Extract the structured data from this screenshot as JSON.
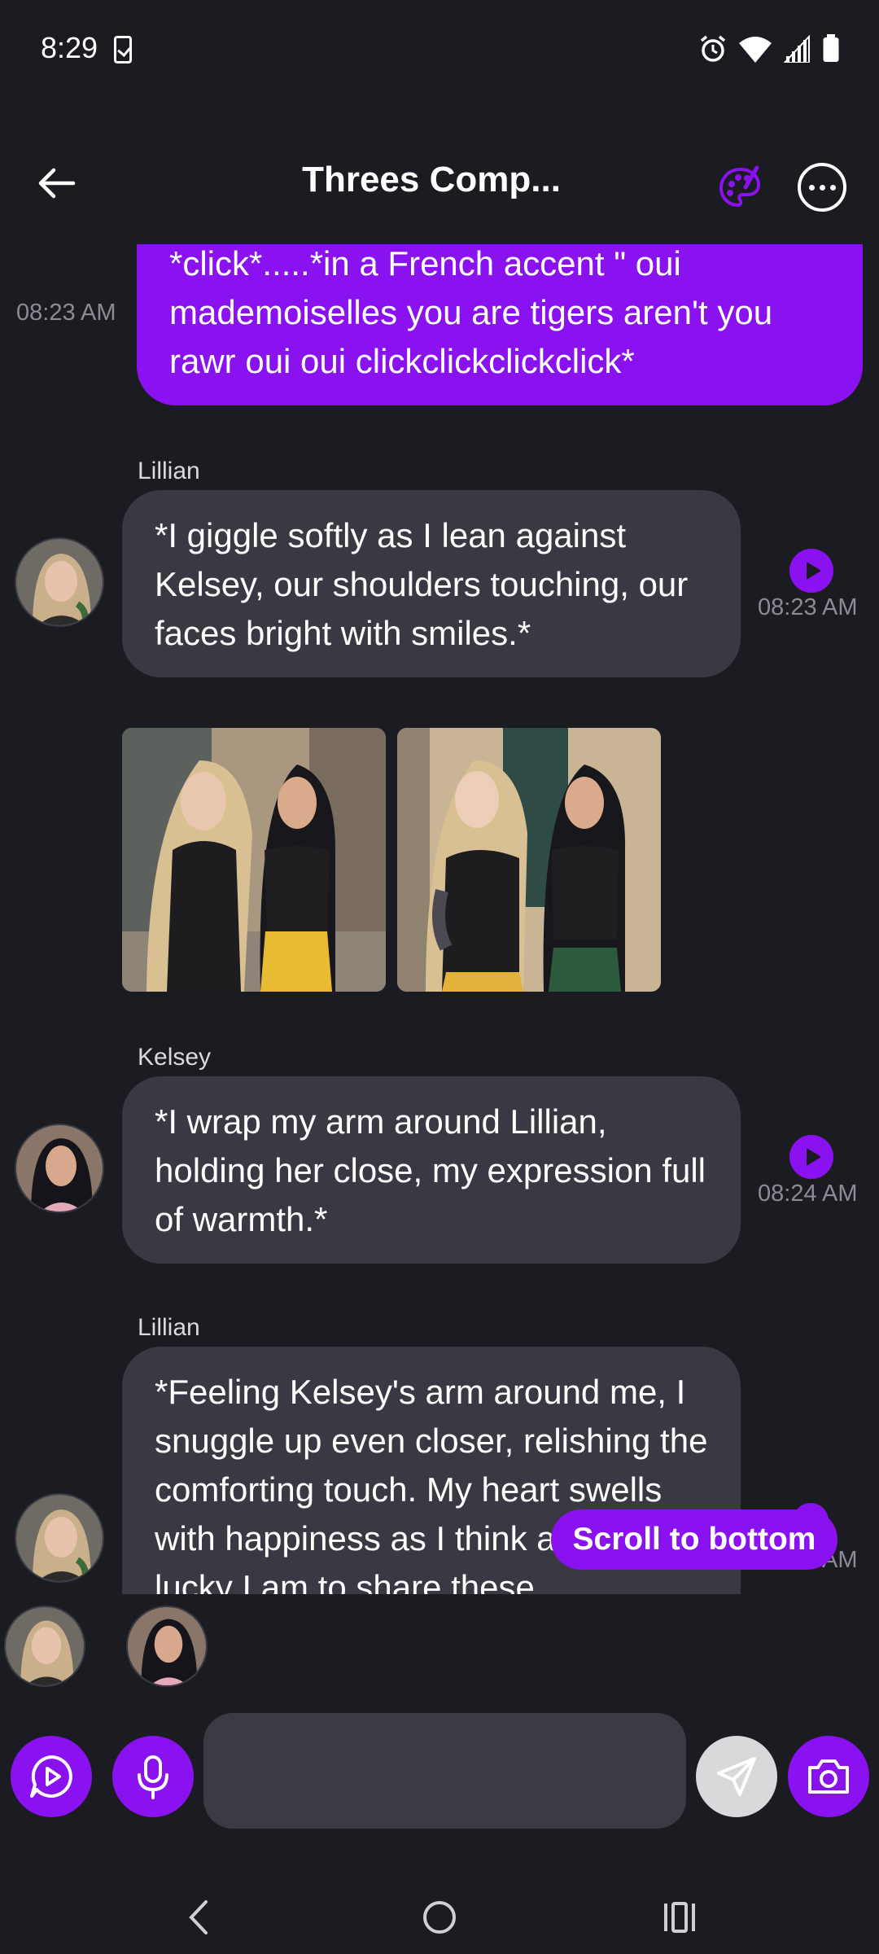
{
  "status_bar": {
    "time": "8:29"
  },
  "header": {
    "title": "Threes Comp..."
  },
  "messages": [
    {
      "type": "user",
      "time": "08:23 AM",
      "text": "*click*.....*in a French accent \" oui mademoiselles you are tigers aren't you rawr oui oui clickclickclickclick*"
    },
    {
      "type": "bot",
      "sender": "Lillian",
      "time": "08:23 AM",
      "text": "*I giggle softly as I lean against Kelsey, our shoulders touching, our faces bright with smiles.*"
    },
    {
      "type": "images",
      "images": [
        "photo-two-women-street",
        "photo-two-women-phone"
      ]
    },
    {
      "type": "bot",
      "sender": "Kelsey",
      "time": "08:24 AM",
      "text": "*I wrap my arm around Lillian, holding her close, my expression full of warmth.*"
    },
    {
      "type": "bot",
      "sender": "Lillian",
      "time": "AM",
      "text": "*Feeling Kelsey's arm around me, I snuggle up even closer, relishing the comforting touch. My heart swells with happiness as I think about how lucky I am to share these"
    }
  ],
  "scroll_button": {
    "label": "Scroll to bottom"
  },
  "composer": {
    "placeholder": ""
  },
  "colors": {
    "accent": "#8a11f0",
    "background": "#1b1b22",
    "bubble_bot": "#383942",
    "input_bg": "#393a42"
  }
}
